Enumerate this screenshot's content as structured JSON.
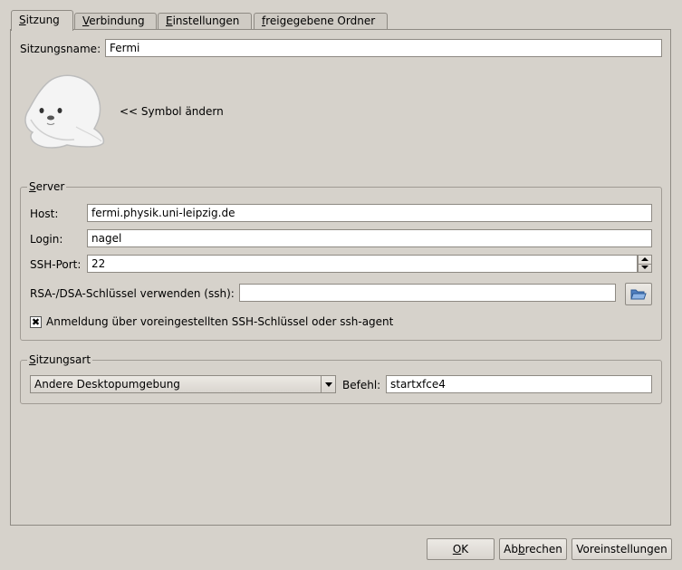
{
  "tabs": [
    {
      "pre": "",
      "ul": "S",
      "post": "itzung"
    },
    {
      "pre": "",
      "ul": "V",
      "post": "erbindung"
    },
    {
      "pre": "",
      "ul": "E",
      "post": "instellungen"
    },
    {
      "pre": "",
      "ul": "f",
      "post": "reigegebene Ordner"
    }
  ],
  "session": {
    "name_label": "Sitzungsname:",
    "name_value": "Fermi",
    "icon_name": "seal-icon",
    "change_icon_label": "<< Symbol ändern"
  },
  "server": {
    "title_ul": "S",
    "title_rest": "erver",
    "host_label": "Host:",
    "host_value": "fermi.physik.uni-leipzig.de",
    "login_label": "Login:",
    "login_value": "nagel",
    "port_label": "SSH-Port:",
    "port_value": "22",
    "rsa_label": "RSA-/DSA-Schlüssel verwenden (ssh):",
    "rsa_value": "",
    "agent_label": "Anmeldung über voreingestellten SSH-Schlüssel oder ssh-agent",
    "agent_checked": "✖"
  },
  "session_type": {
    "title_ul": "S",
    "title_rest": "itzungsart",
    "selected": "Andere Desktopumgebung",
    "command_label": "Befehl:",
    "command_value": "startxfce4"
  },
  "buttons": {
    "ok_ul": "O",
    "ok_rest": "K",
    "cancel_pre": "Ab",
    "cancel_ul": "b",
    "cancel_rest": "rechen",
    "defaults": "Voreinstellungen"
  }
}
